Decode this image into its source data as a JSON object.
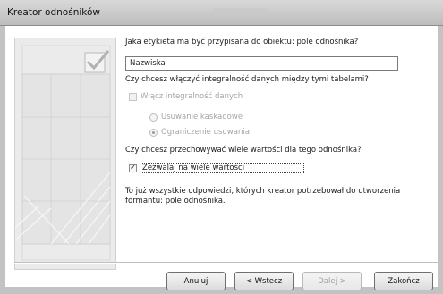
{
  "window": {
    "title": "Kreator odnośników"
  },
  "questions": {
    "label_question": "Jaka etykieta ma być przypisana do obiektu: pole odnośnika?",
    "integrity_question": "Czy chcesz włączyć integralność danych między tymi tabelami?",
    "multi_question": "Czy chcesz przechowywać wiele wartości dla tego odnośnika?",
    "final_text": "To już wszystkie odpowiedzi, których kreator potrzebował do utworzenia formantu: pole odnośnika."
  },
  "label_input": {
    "value": "Nazwiska"
  },
  "integrity": {
    "checkbox_label": "Włącz integralność danych",
    "checked": false,
    "enabled": false,
    "options": [
      {
        "label": "Usuwanie kaskadowe",
        "selected": false
      },
      {
        "label": "Ograniczenie usuwania",
        "selected": true
      }
    ]
  },
  "multi": {
    "checkbox_label": "Zezwalaj na wiele wartości",
    "checked": true,
    "check_glyph": "✓"
  },
  "buttons": {
    "cancel": "Anuluj",
    "back": "< Wstecz",
    "next": "Dalej >",
    "finish": "Zakończ"
  },
  "icons": {
    "illustration": "checkmark-table-icon"
  }
}
